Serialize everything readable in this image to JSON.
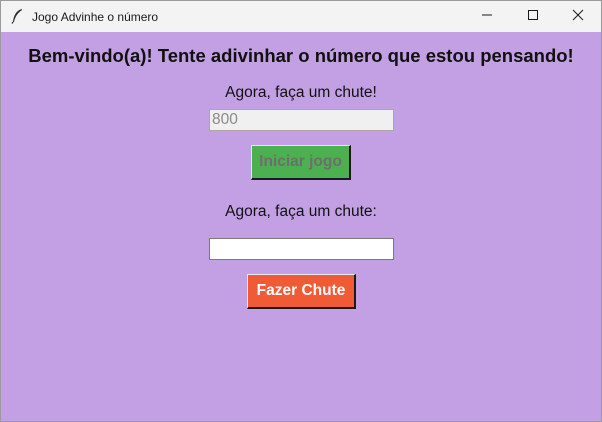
{
  "window": {
    "title": "Jogo Advinhe o número",
    "icon": "feather-icon",
    "controls": [
      "minimize-icon",
      "maximize-icon",
      "close-icon"
    ]
  },
  "game": {
    "heading": "Bem-vindo(a)! Tente adivinhar o número que estou pensando!",
    "range_label": "Agora, faça um chute!",
    "range_value": "800",
    "start_button": "Iniciar jogo",
    "guess_label": "Agora, faça um chute:",
    "guess_value": "",
    "guess_button": "Fazer Chute"
  },
  "colors": {
    "background": "#c3a0e3",
    "start_button": "#4caf50",
    "guess_button": "#f05a34"
  }
}
